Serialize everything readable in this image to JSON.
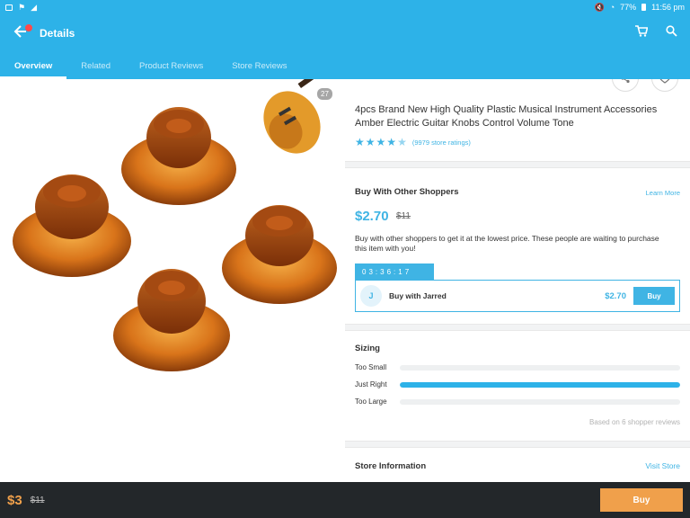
{
  "status_bar": {
    "left_icons": [
      "notification-icon-1",
      "notification-icon-2",
      "notification-icon-3"
    ],
    "battery": "77%",
    "time": "11:56 pm"
  },
  "header": {
    "title": "Details",
    "icons": [
      "back-arrow-icon",
      "cart-icon",
      "search-icon"
    ]
  },
  "tabs": [
    {
      "label": "Overview",
      "active": true
    },
    {
      "label": "Related",
      "active": false
    },
    {
      "label": "Product Reviews",
      "active": false
    },
    {
      "label": "Store Reviews",
      "active": false
    }
  ],
  "gallery": {
    "counter": "27"
  },
  "product": {
    "title": "4pcs Brand New High Quality Plastic Musical Instrument Accessories Amber Electric Guitar Knobs Control Volume Tone",
    "rating": 4.5,
    "ratings_text": "(9979 store ratings)"
  },
  "group_buy": {
    "heading": "Buy With Other Shoppers",
    "learn_more": "Learn More",
    "price": "$2.70",
    "original_price": "$11",
    "description": "Buy with other shoppers to get it at the lowest price. These people are waiting to purchase this item with you!",
    "timer": "03:36:17",
    "shopper_initial": "J",
    "shopper_label": "Buy with Jarred",
    "shopper_price": "$2.70",
    "buy_label": "Buy"
  },
  "sizing": {
    "heading": "Sizing",
    "rows": [
      {
        "label": "Too Small",
        "fraction": 0.0
      },
      {
        "label": "Just Right",
        "fraction": 1.0
      },
      {
        "label": "Too Large",
        "fraction": 0.0
      }
    ],
    "note": "Based on 6 shopper reviews"
  },
  "store": {
    "heading": "Store Information",
    "visit_label": "Visit Store"
  },
  "bottom_bar": {
    "price": "$3",
    "original_price": "$11",
    "buy_label": "Buy"
  },
  "colors": {
    "brand": "#2db2e8",
    "accent": "#3fb4e4",
    "buy_orange": "#f0a04b",
    "bottom_bar": "#23272a"
  }
}
